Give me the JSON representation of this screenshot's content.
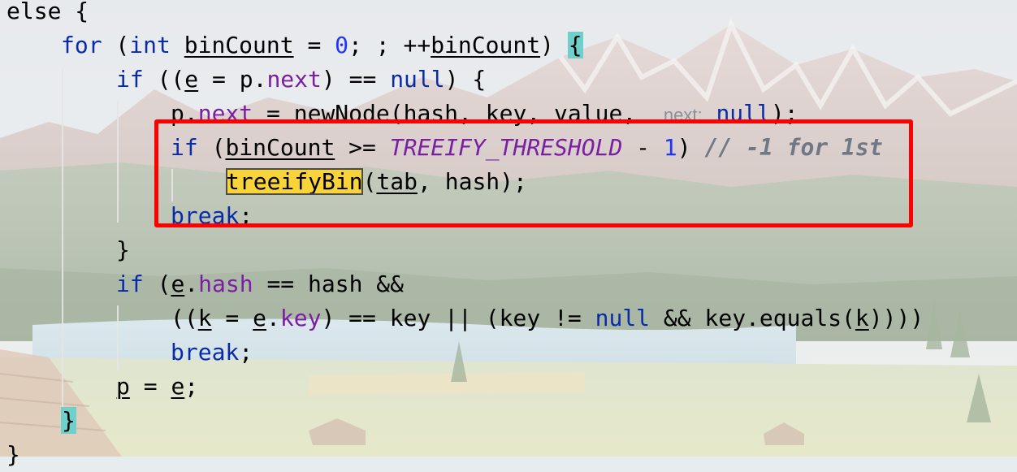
{
  "editor": {
    "lines": [
      {
        "id": "else-open",
        "tokens": [
          {
            "text": "else {",
            "cls": ""
          }
        ]
      },
      {
        "id": "for-loop",
        "tokens": [
          {
            "text": "for",
            "cls": "kw"
          },
          {
            "text": " (",
            "cls": ""
          },
          {
            "text": "int",
            "cls": "kw"
          },
          {
            "text": " ",
            "cls": ""
          },
          {
            "text": "binCount",
            "cls": "underline"
          },
          {
            "text": " = ",
            "cls": ""
          },
          {
            "text": "0",
            "cls": "num"
          },
          {
            "text": "; ; ++",
            "cls": ""
          },
          {
            "text": "binCount",
            "cls": "underline"
          },
          {
            "text": ") ",
            "cls": ""
          },
          {
            "text": "{",
            "cls": "brace-highlight"
          }
        ]
      },
      {
        "id": "if-e-null",
        "tokens": [
          {
            "text": "if",
            "cls": "kw"
          },
          {
            "text": " ((",
            "cls": ""
          },
          {
            "text": "e",
            "cls": "underline"
          },
          {
            "text": " = p.",
            "cls": ""
          },
          {
            "text": "next",
            "cls": "field"
          },
          {
            "text": ") == ",
            "cls": ""
          },
          {
            "text": "null",
            "cls": "kw"
          },
          {
            "text": ") {",
            "cls": ""
          }
        ]
      },
      {
        "id": "p-next-newnode",
        "tokens": [
          {
            "text": "p.",
            "cls": ""
          },
          {
            "text": "next",
            "cls": "field"
          },
          {
            "text": " = newNode(hash, key, value,  ",
            "cls": ""
          },
          {
            "text": "next:",
            "cls": "param-hint"
          },
          {
            "text": " ",
            "cls": ""
          },
          {
            "text": "null",
            "cls": "kw"
          },
          {
            "text": ");",
            "cls": ""
          }
        ]
      },
      {
        "id": "if-bincount-threshold",
        "tokens": [
          {
            "text": "if",
            "cls": "kw"
          },
          {
            "text": " (",
            "cls": ""
          },
          {
            "text": "binCount",
            "cls": "underline"
          },
          {
            "text": " >= ",
            "cls": ""
          },
          {
            "text": "TREEIFY_THRESHOLD",
            "cls": "const"
          },
          {
            "text": " - ",
            "cls": ""
          },
          {
            "text": "1",
            "cls": "num"
          },
          {
            "text": ") ",
            "cls": ""
          },
          {
            "text": "// -1 for 1st",
            "cls": "comment"
          }
        ]
      },
      {
        "id": "treeifybin-call",
        "tokens": [
          {
            "text": "treeifyBin",
            "cls": "search-highlight"
          },
          {
            "text": "(",
            "cls": ""
          },
          {
            "text": "tab",
            "cls": "underline"
          },
          {
            "text": ", hash);",
            "cls": ""
          }
        ]
      },
      {
        "id": "break-1",
        "tokens": [
          {
            "text": "break",
            "cls": "kw"
          },
          {
            "text": ";",
            "cls": ""
          }
        ]
      },
      {
        "id": "close-if-1",
        "tokens": [
          {
            "text": "}",
            "cls": ""
          }
        ]
      },
      {
        "id": "if-e-hash",
        "tokens": [
          {
            "text": "if",
            "cls": "kw"
          },
          {
            "text": " (",
            "cls": ""
          },
          {
            "text": "e",
            "cls": "underline"
          },
          {
            "text": ".",
            "cls": ""
          },
          {
            "text": "hash",
            "cls": "field"
          },
          {
            "text": " == hash &&",
            "cls": ""
          }
        ]
      },
      {
        "id": "key-equals",
        "tokens": [
          {
            "text": "((",
            "cls": ""
          },
          {
            "text": "k",
            "cls": "underline"
          },
          {
            "text": " = ",
            "cls": ""
          },
          {
            "text": "e",
            "cls": "underline"
          },
          {
            "text": ".",
            "cls": ""
          },
          {
            "text": "key",
            "cls": "field"
          },
          {
            "text": ") == key || (key != ",
            "cls": ""
          },
          {
            "text": "null",
            "cls": "kw"
          },
          {
            "text": " && key.equals(",
            "cls": ""
          },
          {
            "text": "k",
            "cls": "underline"
          },
          {
            "text": "))))",
            "cls": ""
          }
        ]
      },
      {
        "id": "break-2",
        "tokens": [
          {
            "text": "break",
            "cls": "kw"
          },
          {
            "text": ";",
            "cls": ""
          }
        ]
      },
      {
        "id": "p-equals-e",
        "tokens": [
          {
            "text": "p",
            "cls": "underline"
          },
          {
            "text": " = ",
            "cls": ""
          },
          {
            "text": "e",
            "cls": "underline"
          },
          {
            "text": ";",
            "cls": ""
          }
        ]
      },
      {
        "id": "close-for",
        "tokens": [
          {
            "text": "}",
            "cls": "brace-highlight"
          }
        ]
      },
      {
        "id": "close-else",
        "tokens": [
          {
            "text": "}",
            "cls": ""
          }
        ]
      }
    ]
  },
  "annotation": {
    "box_color": "#ff0000"
  }
}
